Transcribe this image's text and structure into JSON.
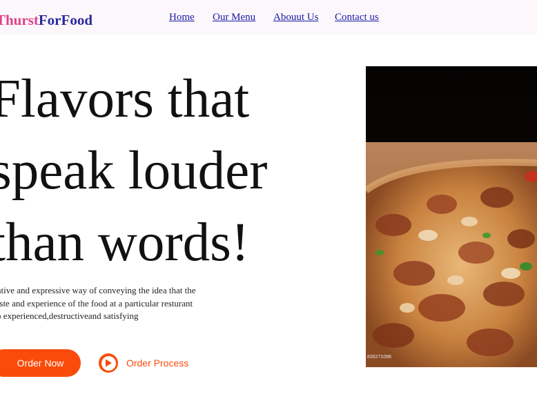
{
  "brand": {
    "name_part1": "Thurst",
    "name_part2": "ForFood",
    "color_part1": "#e0438a",
    "color_part2": "#2a2a9a"
  },
  "nav": {
    "items": [
      {
        "label": "Home"
      },
      {
        "label": "Our Menu"
      },
      {
        "label": "Abouut Us"
      },
      {
        "label": "Contact us"
      }
    ]
  },
  "hero": {
    "title_line1": "Flavors that",
    "title_line2": "speak louder",
    "title_line3": "than words!",
    "desc_line1": "eative and expressive way of conveying the idea that the",
    "desc_line2": "taste and experience of the food at a particular resturant",
    "desc_line3": "so experienced,destructiveand satisfying",
    "order_button": "Order Now",
    "process_button": "Order Process",
    "accent_color": "#fb4b0b"
  },
  "image": {
    "subject": "pizza-photo",
    "stock_id": "835271096"
  }
}
